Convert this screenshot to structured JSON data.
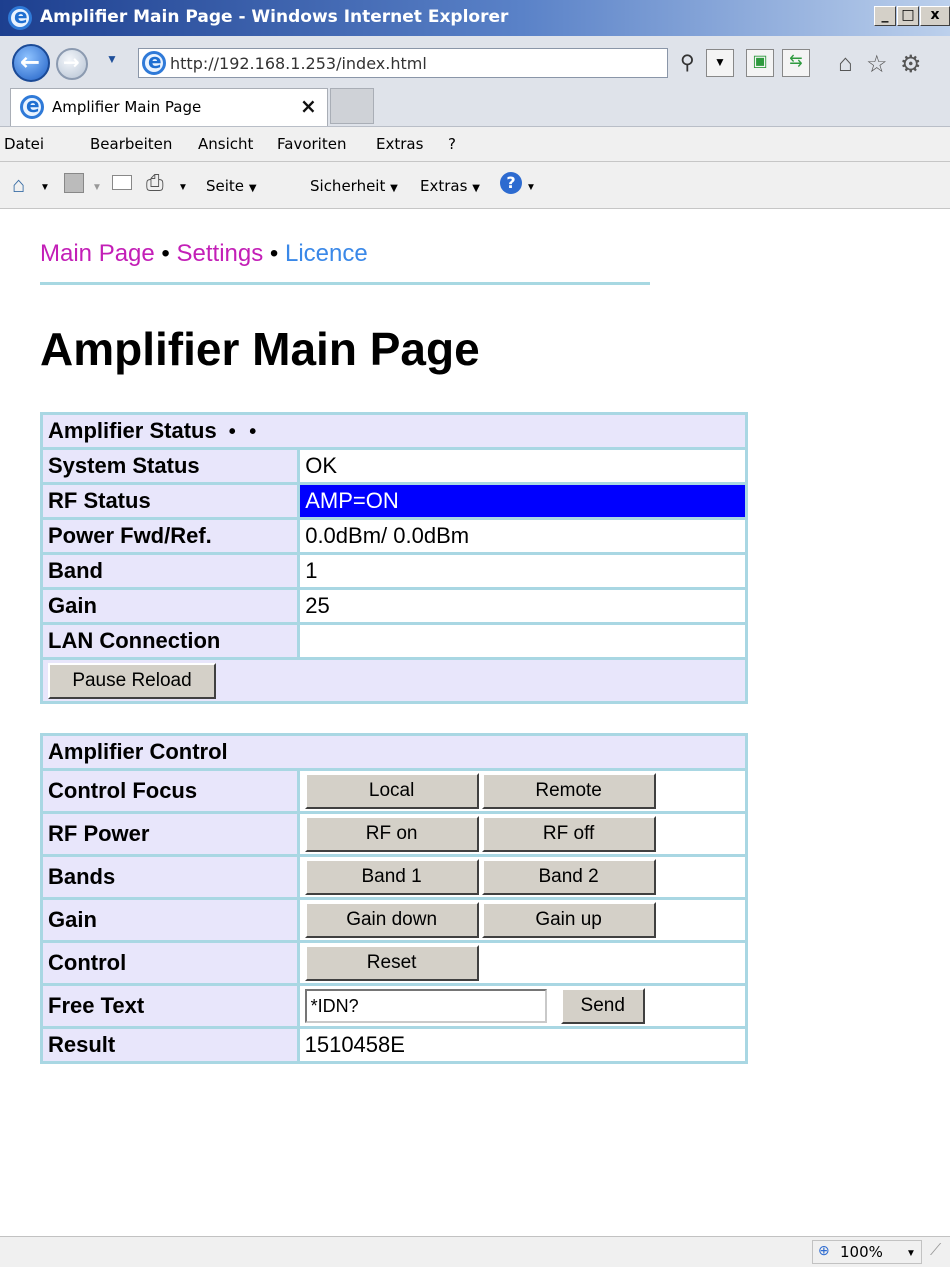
{
  "window": {
    "title": "Amplifier Main Page - Windows Internet Explorer",
    "minimize": "_",
    "maximize": "□",
    "close": "x"
  },
  "browser": {
    "url": "http://192.168.1.253/index.html",
    "tab_title": "Amplifier Main Page",
    "tab_close": "×",
    "menu": [
      "Datei",
      "Bearbeiten",
      "Ansicht",
      "Favoriten",
      "Extras",
      "?"
    ],
    "commands": [
      "Seite",
      "Sicherheit",
      "Extras"
    ],
    "zoom": "100%"
  },
  "nav": {
    "main_page": "Main Page",
    "settings": "Settings",
    "licence": "Licence",
    "separator": "•",
    "colors": {
      "visited": "#c31fb7",
      "link": "#3a88e8"
    }
  },
  "page_title": "Amplifier Main Page",
  "status_table": {
    "header": "Amplifier Status",
    "header_dots": "• •",
    "rows": [
      {
        "label": "System Status",
        "value": "OK"
      },
      {
        "label": "RF Status",
        "value": "AMP=ON",
        "highlight": "#0000ff"
      },
      {
        "label": "Power Fwd/Ref.",
        "value": "0.0dBm/ 0.0dBm"
      },
      {
        "label": "Band",
        "value": "1"
      },
      {
        "label": "Gain",
        "value": "25"
      },
      {
        "label": "LAN Connection",
        "value": ""
      }
    ],
    "pause_button": "Pause Reload"
  },
  "control_table": {
    "header": "Amplifier Control",
    "control_focus": {
      "label": "Control Focus",
      "buttons": [
        "Local",
        "Remote"
      ]
    },
    "rf_power": {
      "label": "RF Power",
      "buttons": [
        "RF on",
        "RF off"
      ]
    },
    "bands": {
      "label": "Bands",
      "buttons": [
        "Band 1",
        "Band 2"
      ]
    },
    "gain": {
      "label": "Gain",
      "buttons": [
        "Gain down",
        "Gain up"
      ]
    },
    "control": {
      "label": "Control",
      "buttons": [
        "Reset"
      ]
    },
    "free_text": {
      "label": "Free Text",
      "value": "*IDN?",
      "send": "Send"
    },
    "result": {
      "label": "Result",
      "value": "1510458E"
    }
  }
}
